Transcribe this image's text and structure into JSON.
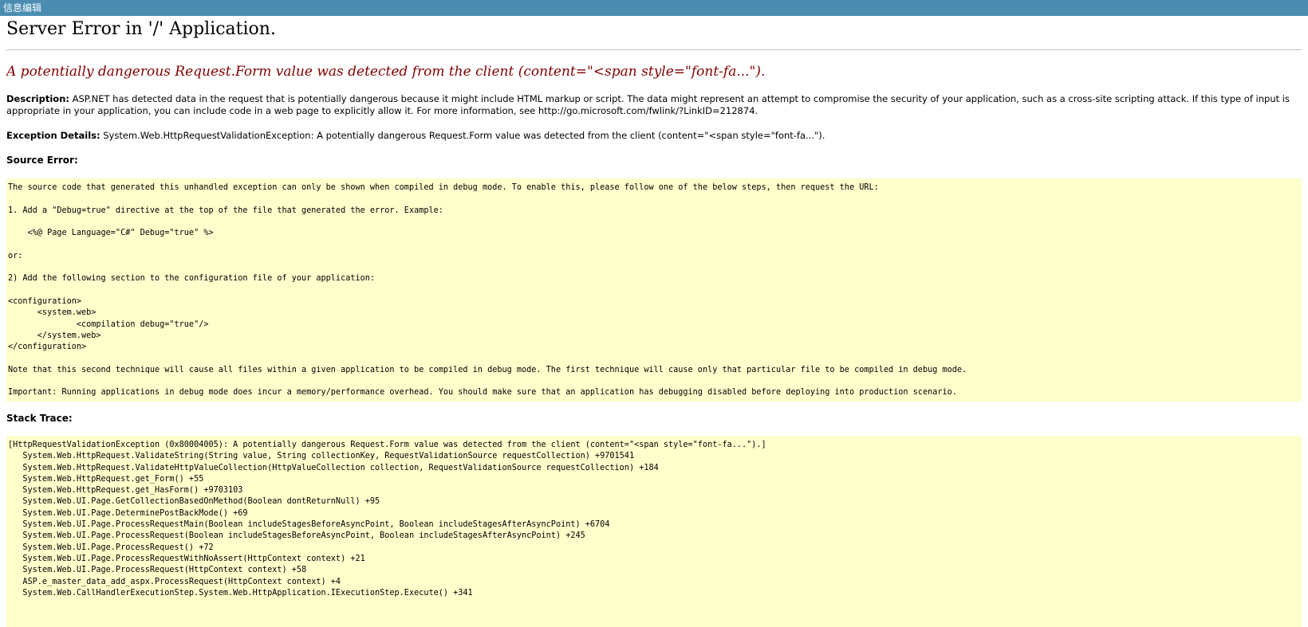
{
  "window": {
    "title": "信息编辑"
  },
  "error": {
    "heading": "Server Error in '/' Application.",
    "subheading": "A potentially dangerous Request.Form value was detected from the client (content=\"<span style=\"font-fa...\").",
    "description_label": "Description:",
    "description_text": " ASP.NET has detected data in the request that is potentially dangerous because it might include HTML markup or script. The data might represent an attempt to compromise the security of your application, such as a cross-site scripting attack. If this type of input is appropriate in your application, you can include code in a web page to explicitly allow it. For more information, see http://go.microsoft.com/fwlink/?LinkID=212874.",
    "exception_label": "Exception Details:",
    "exception_text": " System.Web.HttpRequestValidationException: A potentially dangerous Request.Form value was detected from the client (content=\"<span style=\"font-fa...\")."
  },
  "source_error": {
    "label": "Source Error:",
    "lines": [
      "The source code that generated this unhandled exception can only be shown when compiled in debug mode. To enable this, please follow one of the below steps, then request the URL:",
      "",
      "1. Add a \"Debug=true\" directive at the top of the file that generated the error. Example:",
      "",
      "    <%@ Page Language=\"C#\" Debug=\"true\" %>",
      "",
      "or:",
      "",
      "2) Add the following section to the configuration file of your application:",
      "",
      "<configuration>",
      "      <system.web>",
      "              <compilation debug=\"true\"/>",
      "      </system.web>",
      "</configuration>",
      "",
      "Note that this second technique will cause all files within a given application to be compiled in debug mode. The first technique will cause only that particular file to be compiled in debug mode.",
      "",
      "Important: Running applications in debug mode does incur a memory/performance overhead. You should make sure that an application has debugging disabled before deploying into production scenario."
    ]
  },
  "stack_trace": {
    "label": "Stack Trace:",
    "lines": [
      "[HttpRequestValidationException (0x80004005): A potentially dangerous Request.Form value was detected from the client (content=\"<span style=\"font-fa...\").]",
      "   System.Web.HttpRequest.ValidateString(String value, String collectionKey, RequestValidationSource requestCollection) +9701541",
      "   System.Web.HttpRequest.ValidateHttpValueCollection(HttpValueCollection collection, RequestValidationSource requestCollection) +184",
      "   System.Web.HttpRequest.get_Form() +55",
      "   System.Web.HttpRequest.get_HasForm() +9703103",
      "   System.Web.UI.Page.GetCollectionBasedOnMethod(Boolean dontReturnNull) +95",
      "   System.Web.UI.Page.DeterminePostBackMode() +69",
      "   System.Web.UI.Page.ProcessRequestMain(Boolean includeStagesBeforeAsyncPoint, Boolean includeStagesAfterAsyncPoint) +6704",
      "   System.Web.UI.Page.ProcessRequest(Boolean includeStagesBeforeAsyncPoint, Boolean includeStagesAfterAsyncPoint) +245",
      "   System.Web.UI.Page.ProcessRequest() +72",
      "   System.Web.UI.Page.ProcessRequestWithNoAssert(HttpContext context) +21",
      "   System.Web.UI.Page.ProcessRequest(HttpContext context) +58",
      "   ASP.e_master_data_add_aspx.ProcessRequest(HttpContext context) +4",
      "   System.Web.CallHandlerExecutionStep.System.Web.HttpApplication.IExecutionStep.Execute() +341"
    ]
  },
  "colors": {
    "titlebar_bg": "#4a8db1",
    "subheading": "#800000",
    "code_bg": "#ffffcc"
  }
}
